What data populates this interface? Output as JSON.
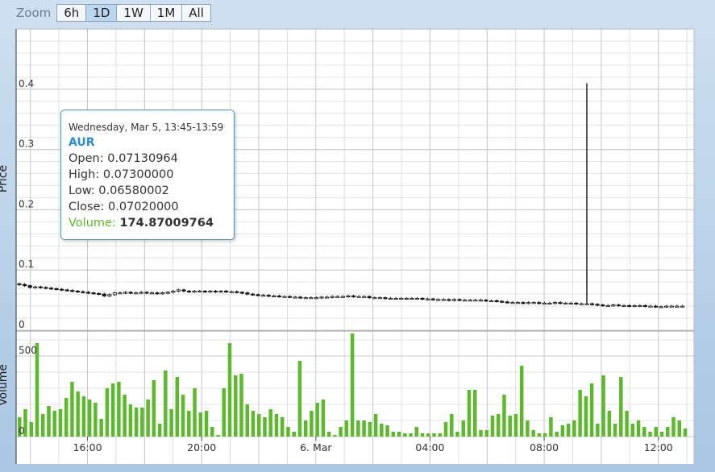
{
  "zoom": {
    "label": "Zoom",
    "buttons": [
      "6h",
      "1D",
      "1W",
      "1M",
      "All"
    ],
    "active": "1D"
  },
  "tooltip": {
    "date": "Wednesday, Mar 5, 13:45-13:59",
    "symbol": "AUR",
    "open_label": "Open:",
    "open_value": "0.07130964",
    "high_label": "High:",
    "high_value": "0.07300000",
    "low_label": "Low:",
    "low_value": "0.06580002",
    "close_label": "Close:",
    "close_value": "0.07020000",
    "volume_label": "Volume:",
    "volume_value": "174.87009764"
  },
  "colors": {
    "candle": "#111111",
    "volume_bar": "#5cb82c",
    "grid": "#c8c8c8",
    "plot_bg": "#ffffff",
    "highlight_candle": "#2b7fc8"
  },
  "chart_data": [
    {
      "type": "candlestick",
      "ylabel": "Price",
      "ylim": [
        0,
        0.5
      ],
      "yticks": [
        "0",
        "0.1",
        "0.2",
        "0.3",
        "0.4"
      ],
      "ytick_values": [
        0,
        0.1,
        0.2,
        0.3,
        0.4
      ],
      "grid": true,
      "x_hours_range": [
        13.5,
        13.25
      ],
      "xticks": [
        {
          "label": "16:00",
          "hour": 16
        },
        {
          "label": "20:00",
          "hour": 20
        },
        {
          "label": "6. Mar",
          "hour": 24
        },
        {
          "label": "04:00",
          "hour": 28
        },
        {
          "label": "08:00",
          "hour": 32
        },
        {
          "label": "12:00",
          "hour": 36
        }
      ],
      "close": [
        0.076,
        0.074,
        0.071,
        0.072,
        0.071,
        0.07,
        0.069,
        0.068,
        0.067,
        0.066,
        0.065,
        0.064,
        0.063,
        0.062,
        0.061,
        0.06,
        0.057,
        0.059,
        0.062,
        0.062,
        0.063,
        0.062,
        0.062,
        0.063,
        0.062,
        0.062,
        0.061,
        0.062,
        0.063,
        0.065,
        0.067,
        0.065,
        0.064,
        0.065,
        0.065,
        0.064,
        0.065,
        0.064,
        0.065,
        0.064,
        0.064,
        0.063,
        0.062,
        0.06,
        0.059,
        0.058,
        0.058,
        0.057,
        0.057,
        0.056,
        0.056,
        0.055,
        0.055,
        0.054,
        0.054,
        0.054,
        0.054,
        0.055,
        0.055,
        0.056,
        0.056,
        0.056,
        0.057,
        0.056,
        0.056,
        0.056,
        0.054,
        0.054,
        0.054,
        0.053,
        0.053,
        0.053,
        0.053,
        0.053,
        0.053,
        0.053,
        0.052,
        0.052,
        0.051,
        0.051,
        0.051,
        0.05,
        0.051,
        0.05,
        0.05,
        0.05,
        0.05,
        0.05,
        0.049,
        0.049,
        0.048,
        0.047,
        0.046,
        0.046,
        0.046,
        0.045,
        0.046,
        0.046,
        0.045,
        0.045,
        0.045,
        0.046,
        0.045,
        0.045,
        0.045,
        0.044,
        0.044,
        0.044,
        0.043,
        0.042,
        0.041,
        0.041,
        0.042,
        0.041,
        0.041,
        0.04,
        0.041,
        0.041,
        0.04,
        0.04,
        0.039,
        0.039,
        0.04,
        0.04,
        0.04,
        0.04
      ],
      "spike": {
        "index": 107,
        "high": 0.41
      },
      "highlight_index": 0
    },
    {
      "type": "bar",
      "ylabel": "Volume",
      "ylim": [
        0,
        650
      ],
      "yticks": [
        "0",
        "500"
      ],
      "ytick_values": [
        0,
        500
      ],
      "volume": [
        120,
        170,
        90,
        580,
        140,
        190,
        160,
        170,
        240,
        340,
        280,
        250,
        230,
        210,
        110,
        300,
        330,
        340,
        260,
        200,
        180,
        180,
        230,
        350,
        80,
        410,
        170,
        370,
        260,
        160,
        300,
        150,
        160,
        60,
        10,
        300,
        580,
        380,
        390,
        200,
        160,
        140,
        120,
        170,
        140,
        120,
        60,
        30,
        470,
        100,
        160,
        210,
        230,
        30,
        10,
        60,
        100,
        640,
        100,
        100,
        90,
        140,
        80,
        70,
        30,
        30,
        20,
        20,
        60,
        20,
        20,
        20,
        20,
        90,
        140,
        30,
        100,
        290,
        290,
        40,
        40,
        130,
        140,
        260,
        130,
        140,
        440,
        100,
        40,
        20,
        20,
        120,
        30,
        70,
        80,
        100,
        290,
        250,
        330,
        80,
        380,
        160,
        80,
        370,
        160,
        80,
        100,
        60,
        30,
        60,
        30,
        60,
        120,
        100,
        50
      ]
    }
  ]
}
